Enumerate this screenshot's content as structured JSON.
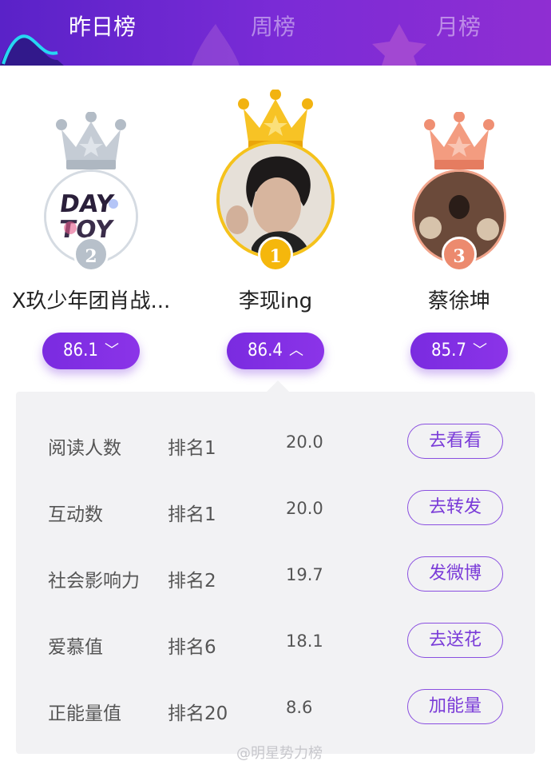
{
  "tabs": [
    {
      "label": "昨日榜",
      "active": true
    },
    {
      "label": "周榜",
      "active": false
    },
    {
      "label": "月榜",
      "active": false
    }
  ],
  "podium": [
    {
      "rank": "2",
      "name": "X玖少年团肖战...",
      "score": "86.1",
      "expanded": false,
      "avatar_text": "DAY TOY",
      "medal_color": "#b9c2cc"
    },
    {
      "rank": "1",
      "name": "李现ing",
      "score": "86.4",
      "expanded": true,
      "medal_color": "#f5b70c"
    },
    {
      "rank": "3",
      "name": "蔡徐坤",
      "score": "85.7",
      "expanded": false,
      "medal_color": "#ec8a6e"
    }
  ],
  "chevron_down": "﹀",
  "chevron_up": "︿",
  "details": [
    {
      "metric": "阅读人数",
      "rank": "排名1",
      "value": "20.0",
      "action": "去看看"
    },
    {
      "metric": "互动数",
      "rank": "排名1",
      "value": "20.0",
      "action": "去转发"
    },
    {
      "metric": "社会影响力",
      "rank": "排名2",
      "value": "19.7",
      "action": "发微博"
    },
    {
      "metric": "爱慕值",
      "rank": "排名6",
      "value": "18.1",
      "action": "去送花"
    },
    {
      "metric": "正能量值",
      "rank": "排名20",
      "value": "8.6",
      "action": "加能量"
    }
  ],
  "watermark": "@明星势力榜",
  "colors": {
    "accent": "#7a2be0",
    "header_start": "#5a22c8",
    "header_end": "#8f2ed2"
  }
}
